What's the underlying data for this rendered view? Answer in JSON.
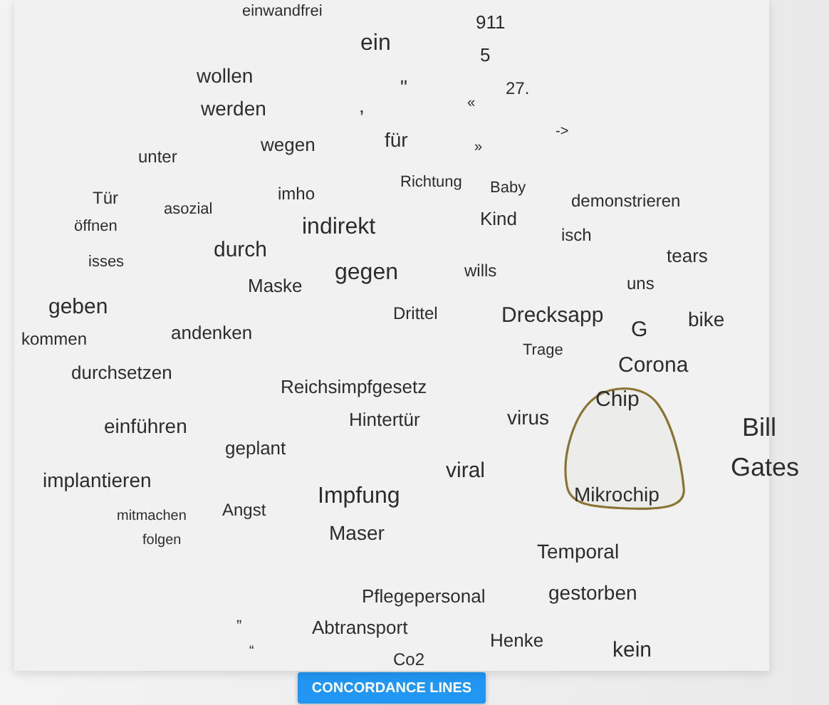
{
  "word_cloud": {
    "lasso_visible": true,
    "words": [
      {
        "text": "einwandfrei"
      },
      {
        "text": "911"
      },
      {
        "text": "ein"
      },
      {
        "text": "5"
      },
      {
        "text": "wollen"
      },
      {
        "text": "\""
      },
      {
        "text": "27."
      },
      {
        "text": "«"
      },
      {
        "text": "werden"
      },
      {
        "text": ","
      },
      {
        "text": "->"
      },
      {
        "text": "wegen"
      },
      {
        "text": "für"
      },
      {
        "text": "»"
      },
      {
        "text": "unter"
      },
      {
        "text": "Richtung"
      },
      {
        "text": "Baby"
      },
      {
        "text": "Tür"
      },
      {
        "text": "asozial"
      },
      {
        "text": "imho"
      },
      {
        "text": "demonstrieren"
      },
      {
        "text": "Kind"
      },
      {
        "text": "öffnen"
      },
      {
        "text": "indirekt"
      },
      {
        "text": "isch"
      },
      {
        "text": "durch"
      },
      {
        "text": "isses"
      },
      {
        "text": "tears"
      },
      {
        "text": "gegen"
      },
      {
        "text": "wills"
      },
      {
        "text": "Maske"
      },
      {
        "text": "uns"
      },
      {
        "text": "geben"
      },
      {
        "text": "Drittel"
      },
      {
        "text": "Drecksapp"
      },
      {
        "text": "G"
      },
      {
        "text": "bike"
      },
      {
        "text": "kommen"
      },
      {
        "text": "andenken"
      },
      {
        "text": "Trage"
      },
      {
        "text": "durchsetzen"
      },
      {
        "text": "Corona"
      },
      {
        "text": "Reichsimpfgesetz"
      },
      {
        "text": "Chip"
      },
      {
        "text": "einführen"
      },
      {
        "text": "Hintertür"
      },
      {
        "text": "virus"
      },
      {
        "text": "Bill"
      },
      {
        "text": "geplant"
      },
      {
        "text": "Gates"
      },
      {
        "text": "viral"
      },
      {
        "text": "implantieren"
      },
      {
        "text": "Impfung"
      },
      {
        "text": "Mikrochip"
      },
      {
        "text": "Angst"
      },
      {
        "text": "mitmachen"
      },
      {
        "text": "Maser"
      },
      {
        "text": "folgen"
      },
      {
        "text": "Temporal"
      },
      {
        "text": "Pflegepersonal"
      },
      {
        "text": "gestorben"
      },
      {
        "text": "”"
      },
      {
        "text": "Abtransport"
      },
      {
        "text": "Henke"
      },
      {
        "text": "“"
      },
      {
        "text": "kein"
      },
      {
        "text": "Co2"
      }
    ]
  },
  "button": {
    "label": "CONCORDANCE LINES"
  }
}
